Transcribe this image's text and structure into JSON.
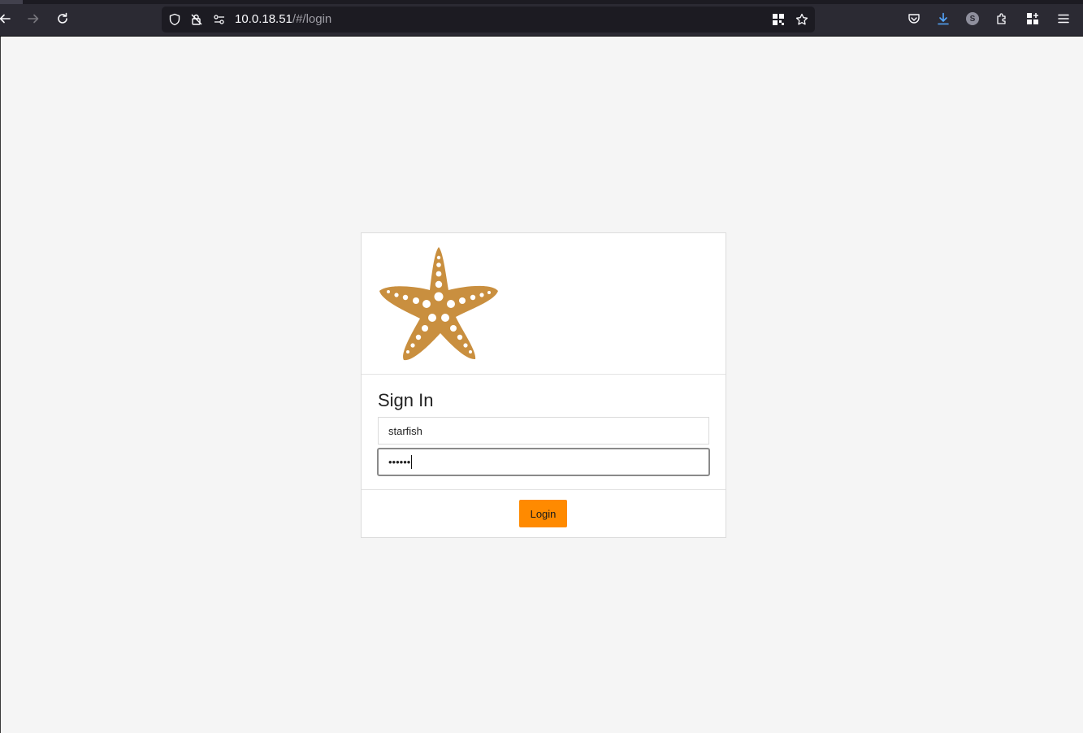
{
  "browser": {
    "url_host": "10.0.18.51",
    "url_path": "/#/login",
    "toolbar_icons": [
      "back-icon",
      "forward-icon",
      "reload-icon",
      "tracking-shield-icon",
      "insecure-lock-icon",
      "permissions-icon",
      "qr-code-icon",
      "bookmark-star-icon",
      "pocket-icon",
      "downloads-icon",
      "account-icon",
      "extensions-icon",
      "containers-icon",
      "menu-icon"
    ],
    "account_initial": "S"
  },
  "login": {
    "logo": "starfish-logo",
    "title": "Sign In",
    "username_value": "starfish",
    "password_masked": "••••••",
    "submit_label": "Login"
  },
  "colors": {
    "accent": "#ff8a00",
    "starfish": "#c98f3f",
    "page_bg": "#f5f5f5"
  }
}
